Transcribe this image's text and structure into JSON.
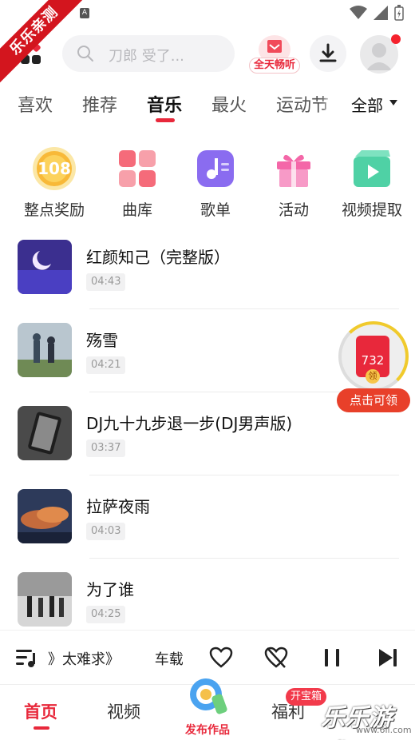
{
  "status_bar": {
    "notif_letter": "A"
  },
  "ribbon": {
    "text": "乐乐亲测"
  },
  "header": {
    "search_placeholder": "刀郎 受了...",
    "all_day_label": "全天畅听"
  },
  "tabs": {
    "items": [
      "喜欢",
      "推荐",
      "音乐",
      "最火",
      "运动节"
    ],
    "active": "音乐",
    "all_label": "全部"
  },
  "quick_entries": [
    {
      "label": "整点奖励",
      "icon": "coin-108-icon",
      "badge": "108"
    },
    {
      "label": "曲库",
      "icon": "library-icon"
    },
    {
      "label": "歌单",
      "icon": "playlist-icon"
    },
    {
      "label": "活动",
      "icon": "gift-icon"
    },
    {
      "label": "视频提取",
      "icon": "video-extract-icon"
    }
  ],
  "songs": [
    {
      "title": "红颜知己（完整版）",
      "duration": "04:43"
    },
    {
      "title": "殇雪",
      "duration": "04:21"
    },
    {
      "title": "DJ九十九步退一步(DJ男声版)",
      "duration": "03:37"
    },
    {
      "title": "拉萨夜雨",
      "duration": "04:03"
    },
    {
      "title": "为了谁",
      "duration": "04:25"
    }
  ],
  "reward": {
    "amount": "732",
    "coin_text": "领",
    "cta": "点击可领"
  },
  "player": {
    "now_playing_1": "》太难求》",
    "now_playing_2": "车载"
  },
  "bottom_nav": {
    "home": "首页",
    "video": "视频",
    "publish": "发布作品",
    "welfare": "福利",
    "welfare_badge": "开宝箱",
    "watermark": "乐乐游戏",
    "watermark_url": "www.6ll.com"
  },
  "colors": {
    "accent": "#e8283b",
    "ribbon": "#d3151e"
  }
}
